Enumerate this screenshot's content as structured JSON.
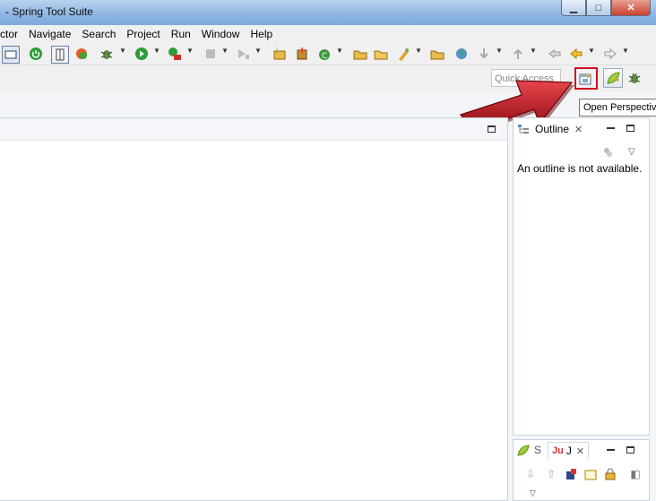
{
  "window": {
    "title": "- Spring Tool Suite",
    "controls": {
      "minimize": "▁",
      "maximize": "□",
      "close": "✕"
    }
  },
  "menu": [
    "ctor",
    "Navigate",
    "Search",
    "Project",
    "Run",
    "Window",
    "Help"
  ],
  "quick_access": {
    "placeholder": "Quick Access"
  },
  "tooltip": {
    "text": "Open Perspective"
  },
  "outline": {
    "tab_label": "Outline",
    "message": "An outline is not available."
  },
  "bottom_panel": {
    "tab1_label": "S",
    "tab2_label": "J",
    "tab2_icon_text": "Ju"
  },
  "colors": {
    "highlight_border": "#d01020",
    "arrow": "#c8141e"
  }
}
